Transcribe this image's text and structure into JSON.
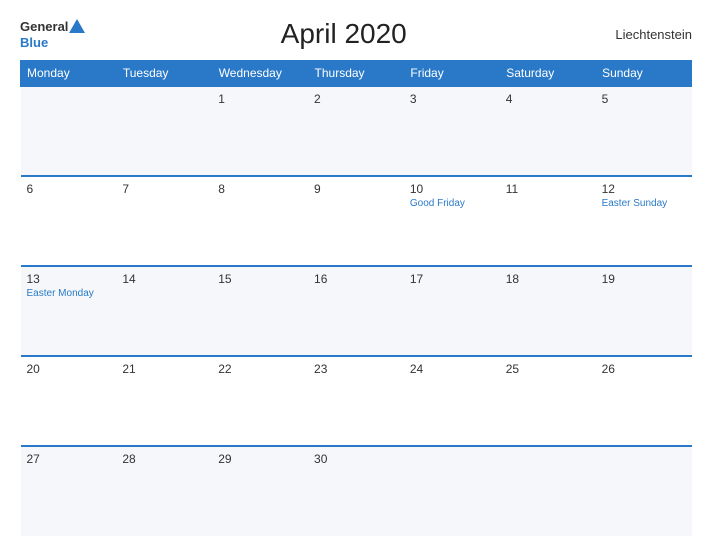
{
  "header": {
    "logo": {
      "general": "General",
      "blue": "Blue"
    },
    "title": "April 2020",
    "country": "Liechtenstein"
  },
  "weekdays": [
    "Monday",
    "Tuesday",
    "Wednesday",
    "Thursday",
    "Friday",
    "Saturday",
    "Sunday"
  ],
  "weeks": [
    [
      {
        "day": "",
        "holiday": ""
      },
      {
        "day": "",
        "holiday": ""
      },
      {
        "day": "1",
        "holiday": ""
      },
      {
        "day": "2",
        "holiday": ""
      },
      {
        "day": "3",
        "holiday": ""
      },
      {
        "day": "4",
        "holiday": ""
      },
      {
        "day": "5",
        "holiday": ""
      }
    ],
    [
      {
        "day": "6",
        "holiday": ""
      },
      {
        "day": "7",
        "holiday": ""
      },
      {
        "day": "8",
        "holiday": ""
      },
      {
        "day": "9",
        "holiday": ""
      },
      {
        "day": "10",
        "holiday": "Good Friday"
      },
      {
        "day": "11",
        "holiday": ""
      },
      {
        "day": "12",
        "holiday": "Easter Sunday"
      }
    ],
    [
      {
        "day": "13",
        "holiday": "Easter Monday"
      },
      {
        "day": "14",
        "holiday": ""
      },
      {
        "day": "15",
        "holiday": ""
      },
      {
        "day": "16",
        "holiday": ""
      },
      {
        "day": "17",
        "holiday": ""
      },
      {
        "day": "18",
        "holiday": ""
      },
      {
        "day": "19",
        "holiday": ""
      }
    ],
    [
      {
        "day": "20",
        "holiday": ""
      },
      {
        "day": "21",
        "holiday": ""
      },
      {
        "day": "22",
        "holiday": ""
      },
      {
        "day": "23",
        "holiday": ""
      },
      {
        "day": "24",
        "holiday": ""
      },
      {
        "day": "25",
        "holiday": ""
      },
      {
        "day": "26",
        "holiday": ""
      }
    ],
    [
      {
        "day": "27",
        "holiday": ""
      },
      {
        "day": "28",
        "holiday": ""
      },
      {
        "day": "29",
        "holiday": ""
      },
      {
        "day": "30",
        "holiday": ""
      },
      {
        "day": "",
        "holiday": ""
      },
      {
        "day": "",
        "holiday": ""
      },
      {
        "day": "",
        "holiday": ""
      }
    ]
  ]
}
